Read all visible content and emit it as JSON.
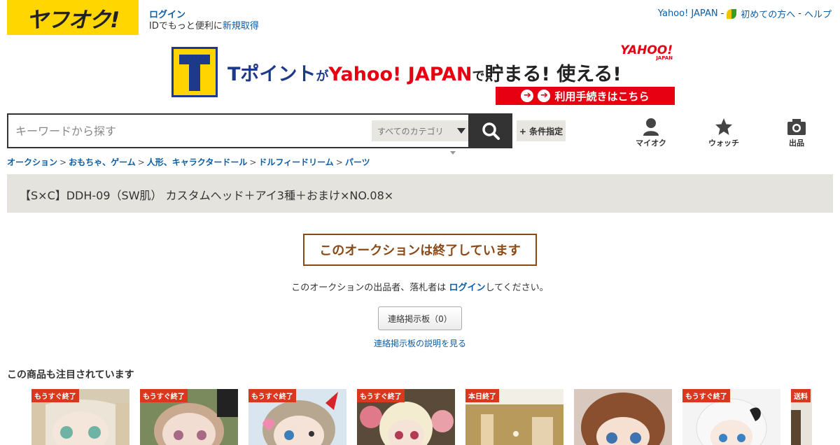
{
  "header": {
    "logo_text": "ヤフオク!",
    "login_label": "ログイン",
    "id_text": "IDでもっと便利に",
    "register_label": "新規取得",
    "yahoo_japan": "Yahoo! JAPAN",
    "sep1": "-",
    "first_time": "初めての方へ",
    "sep2": "-",
    "help": "ヘルプ"
  },
  "banner": {
    "tpoint": "Tポイント",
    "ga": "が",
    "yahoo_japan": "Yahoo! JAPAN",
    "de": "で",
    "tamaru": "貯まる! 使える!",
    "logo_text": "YAHOO!",
    "logo_sub": "JAPAN",
    "button_label": "利用手続きはこちら",
    "icon": "arrow-right-circle"
  },
  "search": {
    "placeholder": "キーワードから探す",
    "category": "すべてのカテゴリ",
    "conditions": "+ 条件指定",
    "icon": "search-icon"
  },
  "nav": {
    "my_auction": "マイオク",
    "watch": "ウォッチ",
    "sell": "出品"
  },
  "breadcrumb": {
    "items": [
      "オークション",
      "おもちゃ、ゲーム",
      "人形、キャラクタードール",
      "ドルフィードリーム",
      "パーツ"
    ],
    "sep": ">"
  },
  "item": {
    "title": "【S×C】DDH-09（SW肌） カスタムヘッド＋アイ3種＋おまけ×NO.08×",
    "ended": "このオークションは終了しています",
    "msg_before": "このオークションの出品者、落札者は ",
    "msg_link": "ログイン",
    "msg_after": "してください。",
    "board_button": "連絡掲示板（0）",
    "board_help": "連絡掲示板の説明を見る"
  },
  "recommend": {
    "title": "この商品も注目されています",
    "items": [
      {
        "badge": "もうすぐ終了"
      },
      {
        "badge": "もうすぐ終了"
      },
      {
        "badge": "もうすぐ終了"
      },
      {
        "badge": "もうすぐ終了"
      },
      {
        "badge": "本日終了"
      },
      {
        "badge": ""
      },
      {
        "badge": "もうすぐ終了"
      },
      {
        "badge": "送料"
      }
    ]
  },
  "colors": {
    "logo_bg": "#ffd600",
    "link": "#0b5ea5",
    "ended_border": "#8a4a18",
    "badge": "#d9381e",
    "title_bg": "#e4e3dd"
  }
}
